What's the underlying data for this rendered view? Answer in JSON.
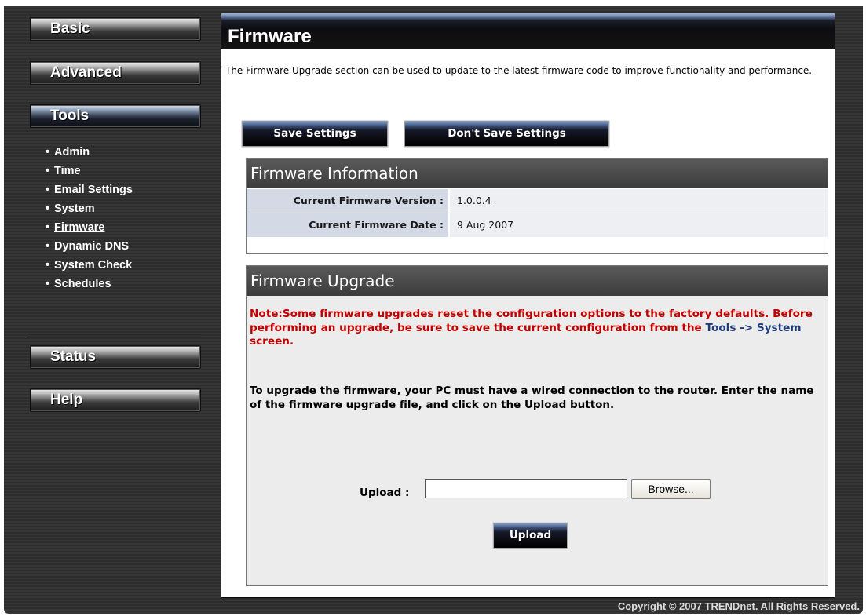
{
  "sidebar": {
    "basic": "Basic",
    "advanced": "Advanced",
    "tools": "Tools",
    "tools_items": [
      "Admin",
      "Time",
      "Email Settings",
      "System",
      "Firmware",
      "Dynamic DNS",
      "System Check",
      "Schedules"
    ],
    "current_item": "Firmware",
    "status": "Status",
    "help": "Help"
  },
  "main": {
    "title": "Firmware",
    "intro": "The Firmware Upgrade section can be used to update to the latest firmware code to improve functionality and performance.",
    "save_label": "Save Settings",
    "dont_save_label": "Don't Save Settings"
  },
  "firmware_info": {
    "heading": "Firmware Information",
    "version_label": "Current Firmware Version :",
    "version_value": "1.0.0.4",
    "date_label": "Current Firmware Date :",
    "date_value": "9 Aug 2007"
  },
  "firmware_upgrade": {
    "heading": "Firmware Upgrade",
    "note_prefix": "Note:Some firmware upgrades reset the configuration options to the factory defaults. Before performing an upgrade, be sure to save the current configuration from the ",
    "note_link": "Tools -> System",
    "note_suffix": " screen.",
    "instructions": "To upgrade the firmware, your PC must have a wired connection to the router. Enter the name of the firmware upgrade file, and click on the Upload button.",
    "upload_label": "Upload :",
    "upload_value": "",
    "browse_label": "Browse...",
    "upload_button": "Upload"
  },
  "footer": {
    "copyright": "Copyright © 2007 TRENDnet. All Rights Reserved."
  },
  "colors": {
    "note_red": "#c00000",
    "link_blue": "#203c78",
    "info_label_bg": "#d4d9e6",
    "info_value_bg": "#edeff3"
  }
}
